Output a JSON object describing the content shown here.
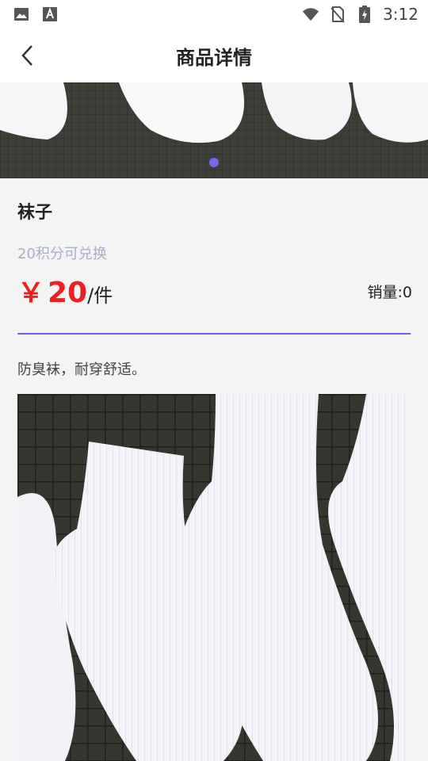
{
  "status_bar": {
    "left_icons": [
      "image-icon",
      "text-a-icon"
    ],
    "right_icons": [
      "wifi-icon",
      "no-sim-icon",
      "battery-charging-icon"
    ],
    "time": "3:12"
  },
  "header": {
    "back_icon": "chevron-left-icon",
    "title": "商品详情"
  },
  "banner": {
    "image": "white-socks-photo",
    "dot_color": "#7766ee"
  },
  "product": {
    "name": "袜子",
    "points_text": "20积分可兑换",
    "currency": "￥",
    "price": "20",
    "unit": "/件",
    "sales": "销量:0",
    "description": "防臭袜，耐穿舒适。"
  },
  "colors": {
    "price": "#f01e1e",
    "accent": "#6b63e6",
    "muted": "#a7aec8"
  },
  "detail_image": {
    "image": "white-socks-closeup-photo"
  }
}
